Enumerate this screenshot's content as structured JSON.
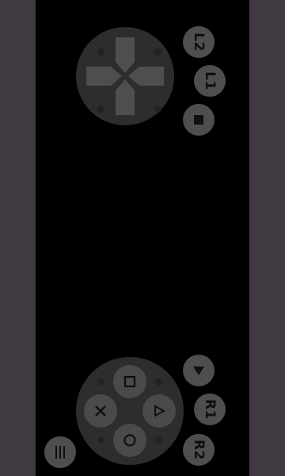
{
  "controller": {
    "buttons": {
      "l2": "L2",
      "l1": "L1",
      "r1": "R1",
      "r2": "R2"
    },
    "icons": {
      "stop": "square-stop-icon",
      "down": "triangle-down-icon",
      "menu": "three-vertical-bars-icon",
      "dpad": "dpad-icon",
      "face_top": "square-symbol-icon",
      "face_left": "cross-symbol-icon",
      "face_right": "triangle-symbol-icon",
      "face_bottom": "circle-symbol-icon"
    },
    "colors": {
      "background_bars": "#403942",
      "screen": "#000000",
      "pad_base": "#2d2d2f",
      "button": "#4e4e50",
      "glyph": "#0f0f10"
    }
  }
}
